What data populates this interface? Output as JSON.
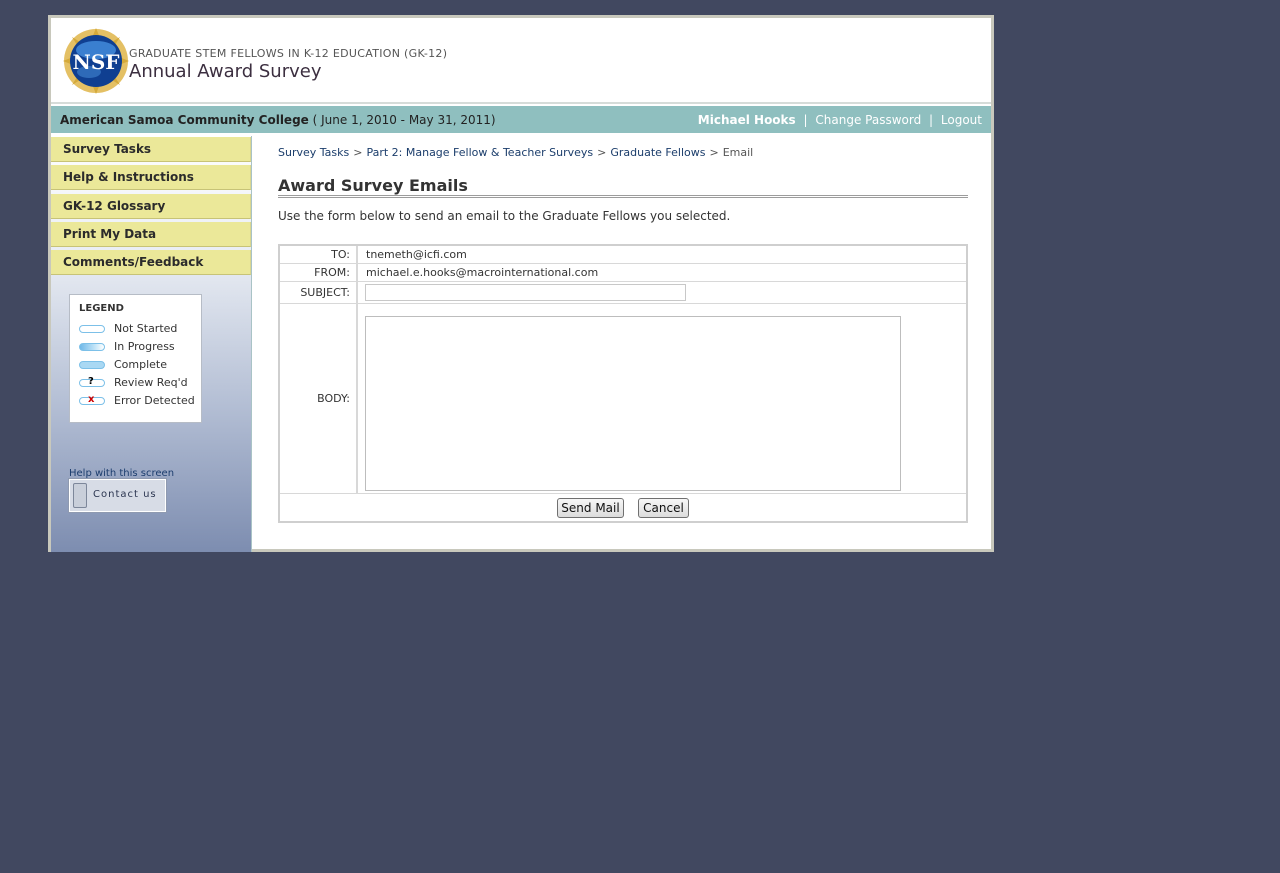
{
  "header": {
    "logo_text": "NSF",
    "program_title": "GRADUATE STEM FELLOWS IN K-12 EDUCATION (GK-12)",
    "survey_title": "Annual Award Survey"
  },
  "orgbar": {
    "organization": "American Samoa Community College",
    "period": "( June 1, 2010 - May 31, 2011)",
    "user": "Michael Hooks",
    "separator": "|",
    "change_password": "Change Password",
    "logout": "Logout"
  },
  "sidebar": {
    "nav": [
      {
        "label": "Survey Tasks"
      },
      {
        "label": "Help & Instructions"
      },
      {
        "label": "GK-12 Glossary"
      },
      {
        "label": "Print My Data"
      },
      {
        "label": "Comments/Feedback"
      }
    ],
    "legend": {
      "title": "LEGEND",
      "items": [
        {
          "label": "Not Started",
          "icon": "status-not-started-icon"
        },
        {
          "label": "In Progress",
          "icon": "status-in-progress-icon"
        },
        {
          "label": "Complete",
          "icon": "status-complete-icon"
        },
        {
          "label": "Review Req'd",
          "icon": "status-review-icon",
          "mark": "?"
        },
        {
          "label": "Error Detected",
          "icon": "status-error-icon",
          "mark": "x"
        }
      ]
    },
    "help_label": "Help with this screen",
    "contact_label": "Contact us"
  },
  "breadcrumb": {
    "items": [
      "Survey Tasks",
      "Part 2: Manage Fellow & Teacher Surveys",
      "Graduate Fellows"
    ],
    "current": "Email",
    "separator": ">"
  },
  "page": {
    "title": "Award Survey Emails",
    "intro": "Use the form below to send an email to the Graduate Fellows you selected."
  },
  "form": {
    "to_label": "TO:",
    "to_value": "tnemeth@icfi.com",
    "from_label": "FROM:",
    "from_value": "michael.e.hooks@macrointernational.com",
    "subject_label": "SUBJECT:",
    "subject_value": "",
    "body_label": "BODY:",
    "body_value": "",
    "send_label": "Send Mail",
    "cancel_label": "Cancel"
  },
  "colors": {
    "background": "#414860",
    "orgbar": "#8fbfbf",
    "nav": "#ebe899",
    "link": "#1b3d6b"
  }
}
